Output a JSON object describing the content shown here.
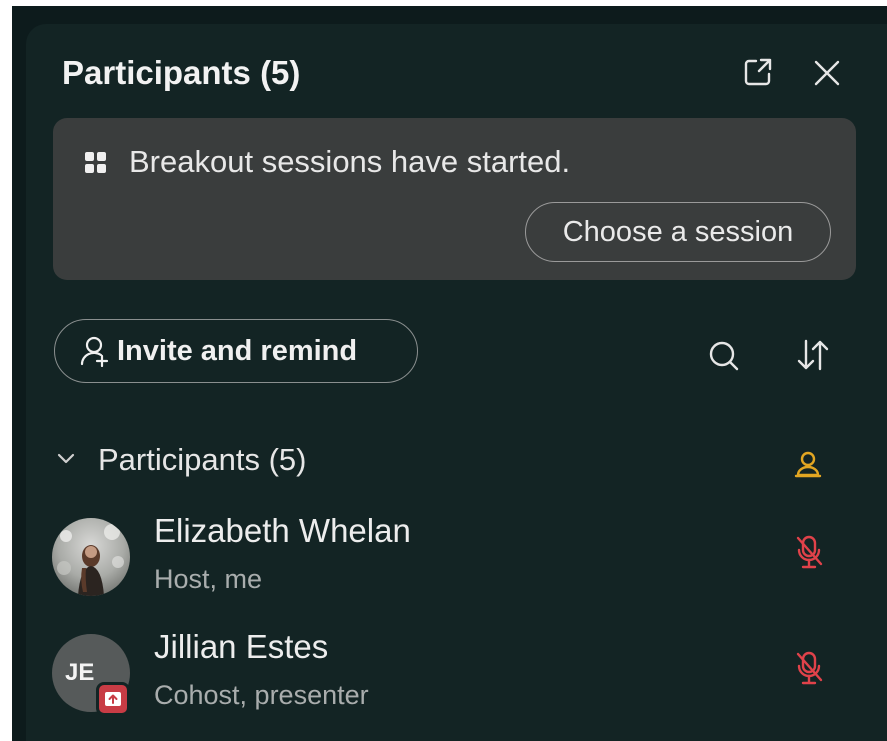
{
  "header": {
    "title": "Participants (5)",
    "popout_icon": "popout-icon",
    "close_icon": "close-icon"
  },
  "banner": {
    "icon": "breakout-grid-icon",
    "message": "Breakout sessions have started.",
    "button_label": "Choose a session"
  },
  "toolbar": {
    "invite_label": "Invite and remind",
    "invite_icon": "person-add-icon",
    "search_icon": "search-icon",
    "sort_icon": "sort-icon"
  },
  "section": {
    "label": "Participants (5)",
    "chevron_icon": "chevron-down-icon",
    "host_badge_icon": "host-badge-icon"
  },
  "participants": [
    {
      "name": "Elizabeth Whelan",
      "role": "Host, me",
      "avatar": "photo",
      "mic_icon": "mic-muted-icon"
    },
    {
      "name": "Jillian Estes",
      "role": "Cohost, presenter",
      "initials": "JE",
      "avatar_badge": "share-screen-badge-icon",
      "mic_icon": "mic-muted-icon"
    }
  ],
  "colors": {
    "panel_bg": "#132424",
    "banner_bg": "#3a3d3d",
    "muted_red": "#e0424a",
    "host_badge": "#e2a622"
  }
}
